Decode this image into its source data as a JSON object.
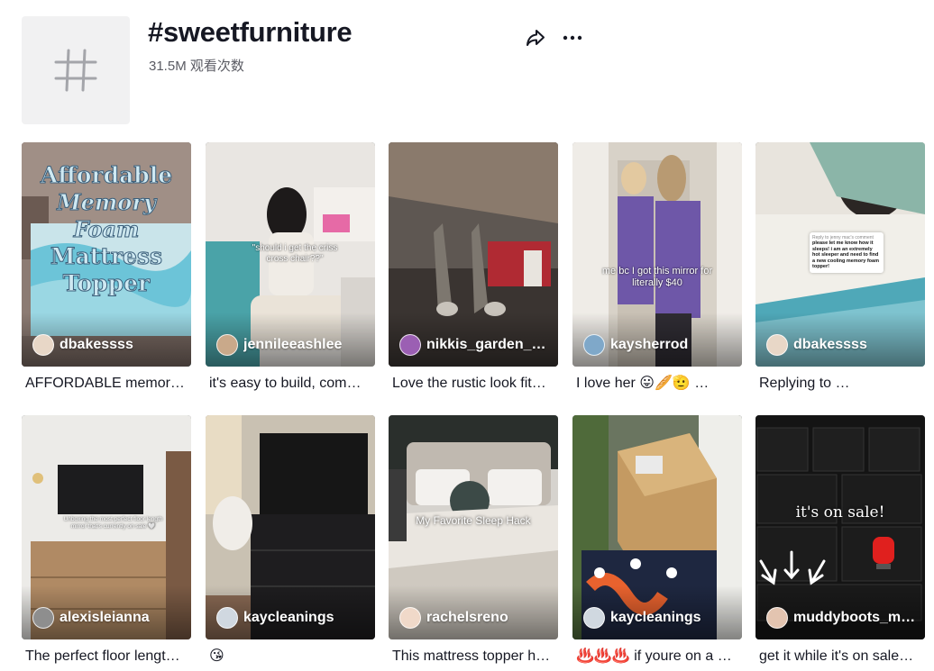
{
  "hashtag": {
    "title": "#sweetfurniture",
    "views": "31.5M 观看次数",
    "avatar_icon": "hash-icon",
    "share_icon": "share-icon",
    "more_icon": "more-icon"
  },
  "videos": [
    {
      "author": "dbakessss",
      "caption": "AFFORDABLE memory…",
      "overlay": [
        "Affordable",
        "Memory",
        "Foam",
        "Mattress",
        "Topper"
      ],
      "avatar_color": "#e8d7c7"
    },
    {
      "author": "jennileeashlee",
      "caption": "it's easy to build, com…",
      "overlay": "\"should i get the criss cross chair??\"",
      "avatar_color": "#c9a98a"
    },
    {
      "author": "nikkis_garden_a…",
      "caption": "Love the rustic look fit…",
      "overlay": "",
      "avatar_color": "#9b5fb3"
    },
    {
      "author": "kaysherrod",
      "caption": "I love her 😛🥖🫡 …",
      "overlay": "me bc I got this mirror for literally $40",
      "avatar_color": "#7fa8c9"
    },
    {
      "author": "dbakessss",
      "caption": "Replying to …",
      "overlay": "please let me know how it sleeps! i am an extremely hot sleeper and need to find a new cooling memory foam topper!",
      "overlay_header": "Reply to jenny mac's comment",
      "avatar_color": "#e8d7c7"
    },
    {
      "author": "alexisleianna",
      "caption": "The perfect floor lengt…",
      "overlay": "Unboxing the most perfect floor length mirror that's currently on sale 🤍",
      "avatar_color": "#8e8e8e"
    },
    {
      "author": "kaycleanings",
      "caption": "😘",
      "overlay": "",
      "avatar_color": "#d0d8e0"
    },
    {
      "author": "rachelsreno",
      "caption": "This mattress topper h…",
      "overlay": "My Favorite Sleep Hack",
      "avatar_color": "#f0d9c9"
    },
    {
      "author": "kaycleanings",
      "caption": "♨️♨️♨️ if youre on a …",
      "overlay": "",
      "avatar_color": "#d0d8e0"
    },
    {
      "author": "muddyboots_m…",
      "caption": "get it while it's on sale…",
      "overlay": "it's on sale!",
      "avatar_color": "#e3c4b0"
    }
  ]
}
